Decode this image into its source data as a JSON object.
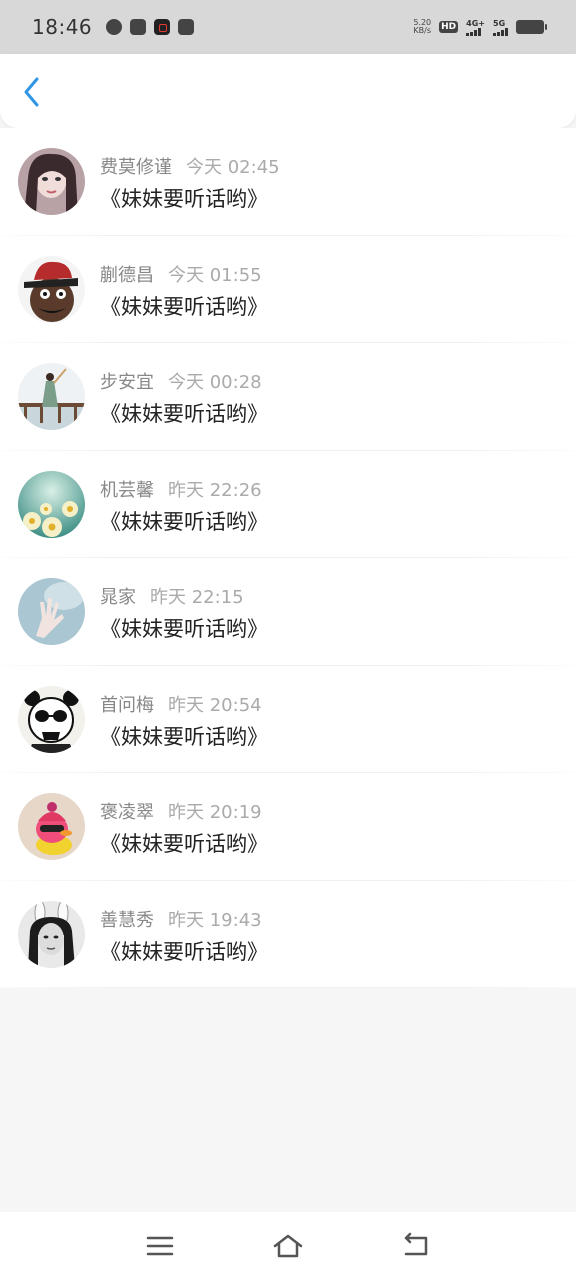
{
  "status_bar": {
    "time": "18:46",
    "net_speed_value": "5.20",
    "net_speed_unit": "KB/s",
    "hd_label": "HD",
    "sim1_label": "4G+",
    "sim2_label": "5G"
  },
  "header": {
    "back_icon": "chevron-left-icon",
    "accent_color": "#2f96e6"
  },
  "comments": [
    {
      "name": "费莫修谨",
      "time": "今天 02:45",
      "message": "《妹妹要听话哟》",
      "avatar": "girl-portrait"
    },
    {
      "name": "蒯德昌",
      "time": "今天 01:55",
      "message": "《妹妹要听话哟》",
      "avatar": "cartoon-man-hat"
    },
    {
      "name": "步安宜",
      "time": "今天 00:28",
      "message": "《妹妹要听话哟》",
      "avatar": "girl-on-bridge"
    },
    {
      "name": "机芸馨",
      "time": "昨天 22:26",
      "message": "《妹妹要听话哟》",
      "avatar": "daisy-flowers"
    },
    {
      "name": "晁家",
      "time": "昨天 22:15",
      "message": "《妹妹要听话哟》",
      "avatar": "hand-sky"
    },
    {
      "name": "首问梅",
      "time": "昨天 20:54",
      "message": "《妹妹要听话哟》",
      "avatar": "panda-skull"
    },
    {
      "name": "褒凌翠",
      "time": "昨天 20:19",
      "message": "《妹妹要听话哟》",
      "avatar": "pink-duck"
    },
    {
      "name": "善慧秀",
      "time": "昨天 19:43",
      "message": "《妹妹要听话哟》",
      "avatar": "bw-girl-bunny-ears"
    }
  ],
  "nav_bar": {
    "menu_icon": "menu-icon",
    "home_icon": "home-icon",
    "back_icon": "back-icon"
  }
}
